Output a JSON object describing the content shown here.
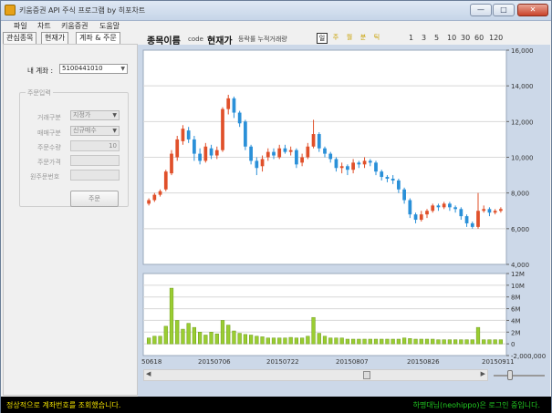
{
  "window": {
    "title": "키움증권 API 주식 프로그램 by 히포차트",
    "min_label": "—",
    "max_label": "□",
    "close_label": "✕"
  },
  "menu": [
    "파일",
    "차트",
    "키움증권",
    "도움말"
  ],
  "tabs": [
    "관심종목",
    "현재가",
    "계좌 & 주문"
  ],
  "account": {
    "label": "내 계좌 :",
    "value": "5100441010"
  },
  "order": {
    "group_title": "주문입력",
    "trade_type_label": "거래구분",
    "trade_type_value": "지정가",
    "side_label": "매매구분",
    "side_value": "신규매수",
    "qty_label": "주문수량",
    "qty_value": "10",
    "price_label": "주문가격",
    "price_value": "",
    "orig_order_label": "원주문번호",
    "orig_order_value": "",
    "submit_label": "주문"
  },
  "header": {
    "stock_name": "종목이름",
    "code_label": "code",
    "current_price": "현재가",
    "change_text": "등락률 누적거래량"
  },
  "period_tabs": [
    {
      "label": "일",
      "active": true
    },
    {
      "label": "주",
      "active": false
    },
    {
      "label": "월",
      "active": false
    },
    {
      "label": "분",
      "active": false
    },
    {
      "label": "틱",
      "active": false
    }
  ],
  "intervals": [
    "1",
    "3",
    "5",
    "10",
    "30",
    "60",
    "120"
  ],
  "chart_data": {
    "type": "candlestick",
    "price_axis": {
      "min": 4000,
      "max": 16000,
      "ticks": [
        "16,000",
        "14,000",
        "12,000",
        "10,000",
        "8,000",
        "6,000",
        "4,000"
      ]
    },
    "volume_axis": {
      "min": -2000000,
      "max": 12000000,
      "ticks": [
        "12M",
        "10M",
        "8M",
        "6M",
        "4M",
        "2M",
        "0",
        "-2,000,000"
      ]
    },
    "x_tick_labels": [
      "50618",
      "20150706",
      "20150722",
      "20150807",
      "20150826",
      "20150911"
    ],
    "colors": {
      "up": "#e0502a",
      "down": "#2a90d8",
      "volume": "#9acd32",
      "volume_edge": "#6b9a18",
      "grid": "#d8d8d8"
    },
    "candles": [
      [
        7400,
        7600,
        7300,
        7700
      ],
      [
        7600,
        7900,
        7500,
        8000
      ],
      [
        7900,
        8100,
        7800,
        8200
      ],
      [
        8200,
        9200,
        8100,
        9300
      ],
      [
        9100,
        10200,
        9000,
        10400
      ],
      [
        10000,
        11000,
        9800,
        11200
      ],
      [
        10900,
        11600,
        10700,
        11800
      ],
      [
        11500,
        11000,
        10800,
        11700
      ],
      [
        11000,
        10200,
        9800,
        11200
      ],
      [
        10200,
        9800,
        9600,
        10500
      ],
      [
        9800,
        10600,
        9700,
        10800
      ],
      [
        10500,
        10100,
        9900,
        10700
      ],
      [
        10100,
        10400,
        9900,
        10600
      ],
      [
        10400,
        12700,
        10300,
        12800
      ],
      [
        12700,
        13300,
        12400,
        13500
      ],
      [
        13300,
        12500,
        12200,
        13400
      ],
      [
        12500,
        11900,
        11700,
        12600
      ],
      [
        12000,
        10600,
        10400,
        12100
      ],
      [
        10600,
        9800,
        9600,
        10700
      ],
      [
        9800,
        9400,
        9000,
        10000
      ],
      [
        9500,
        9900,
        9200,
        10100
      ],
      [
        10000,
        10300,
        9800,
        10500
      ],
      [
        10300,
        10100,
        9900,
        10500
      ],
      [
        10000,
        10500,
        9900,
        10700
      ],
      [
        10500,
        10300,
        10200,
        10700
      ],
      [
        10300,
        10400,
        10100,
        10600
      ],
      [
        10400,
        9600,
        9400,
        10500
      ],
      [
        9700,
        10000,
        9500,
        10200
      ],
      [
        10000,
        10600,
        9900,
        10800
      ],
      [
        10600,
        11300,
        10500,
        12100
      ],
      [
        11300,
        10500,
        10300,
        11400
      ],
      [
        10500,
        10200,
        10000,
        10600
      ],
      [
        10200,
        9900,
        9700,
        10300
      ],
      [
        9900,
        9400,
        9200,
        10000
      ],
      [
        9400,
        9500,
        9100,
        9700
      ],
      [
        9500,
        9300,
        9000,
        9600
      ],
      [
        9300,
        9700,
        9100,
        9900
      ],
      [
        9700,
        9600,
        9400,
        9800
      ],
      [
        9600,
        9800,
        9400,
        10000
      ],
      [
        9800,
        9700,
        9500,
        9900
      ],
      [
        9700,
        9200,
        9000,
        9800
      ],
      [
        9200,
        8900,
        8700,
        9300
      ],
      [
        8900,
        8800,
        8600,
        9000
      ],
      [
        8800,
        8700,
        8500,
        9000
      ],
      [
        8700,
        8200,
        8000,
        8800
      ],
      [
        8200,
        7600,
        7400,
        8300
      ],
      [
        7600,
        6800,
        6600,
        7700
      ],
      [
        6800,
        6500,
        6300,
        6900
      ],
      [
        6500,
        6800,
        6400,
        7000
      ],
      [
        6800,
        7000,
        6600,
        7100
      ],
      [
        7000,
        7300,
        6900,
        7400
      ],
      [
        7300,
        7200,
        7000,
        7400
      ],
      [
        7200,
        7400,
        7100,
        7500
      ],
      [
        7400,
        7200,
        7000,
        7500
      ],
      [
        7200,
        7100,
        6900,
        7300
      ],
      [
        7100,
        6700,
        6500,
        7200
      ],
      [
        6700,
        6300,
        6100,
        6800
      ],
      [
        6300,
        6100,
        6000,
        6400
      ],
      [
        6100,
        7000,
        6000,
        8000
      ],
      [
        7000,
        7100,
        6900,
        7300
      ],
      [
        7100,
        6900,
        6700,
        7200
      ],
      [
        6900,
        7000,
        6800,
        7100
      ],
      [
        7000,
        7100,
        6900,
        7200
      ]
    ],
    "volumes_m": [
      1.0,
      1.3,
      1.3,
      3.0,
      9.5,
      4.0,
      2.5,
      3.5,
      2.8,
      2.0,
      1.5,
      2.0,
      1.7,
      4.0,
      3.2,
      2.2,
      1.8,
      1.6,
      1.5,
      1.3,
      1.2,
      1.0,
      1.0,
      1.0,
      1.0,
      1.1,
      1.0,
      1.0,
      1.3,
      4.5,
      1.8,
      1.3,
      1.0,
      1.0,
      1.0,
      0.8,
      0.8,
      0.8,
      0.8,
      0.8,
      0.8,
      0.8,
      0.8,
      0.8,
      0.8,
      1.0,
      0.9,
      0.8,
      0.8,
      0.8,
      0.8,
      0.7,
      0.7,
      0.7,
      0.7,
      0.7,
      0.7,
      0.7,
      2.8,
      0.7,
      0.7,
      0.7,
      0.7
    ]
  },
  "status": {
    "left": "정상적으로 계좌번호를 조회했습니다.",
    "right": "하명대님(neohippo)은 로그인 중입니다."
  }
}
